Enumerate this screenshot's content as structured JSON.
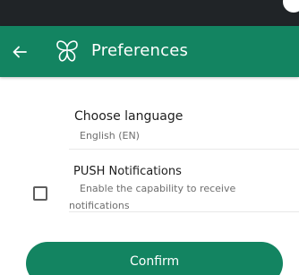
{
  "app_bar": {
    "title": "Preferences",
    "back_icon": "arrow-left-icon",
    "logo_icon": "butterfly-logo-icon"
  },
  "language": {
    "title": "Choose language",
    "value": "English (EN)"
  },
  "push_notifications": {
    "title": "PUSH Notifications",
    "description_line1": "Enable the capability to receive",
    "description_line2": "notifications",
    "checked": false
  },
  "confirm_button": {
    "label": "Confirm"
  },
  "colors": {
    "primary": "#138461",
    "status_bar": "#202427",
    "text_primary": "#1d1d1d",
    "text_secondary": "#6e6e6e"
  }
}
